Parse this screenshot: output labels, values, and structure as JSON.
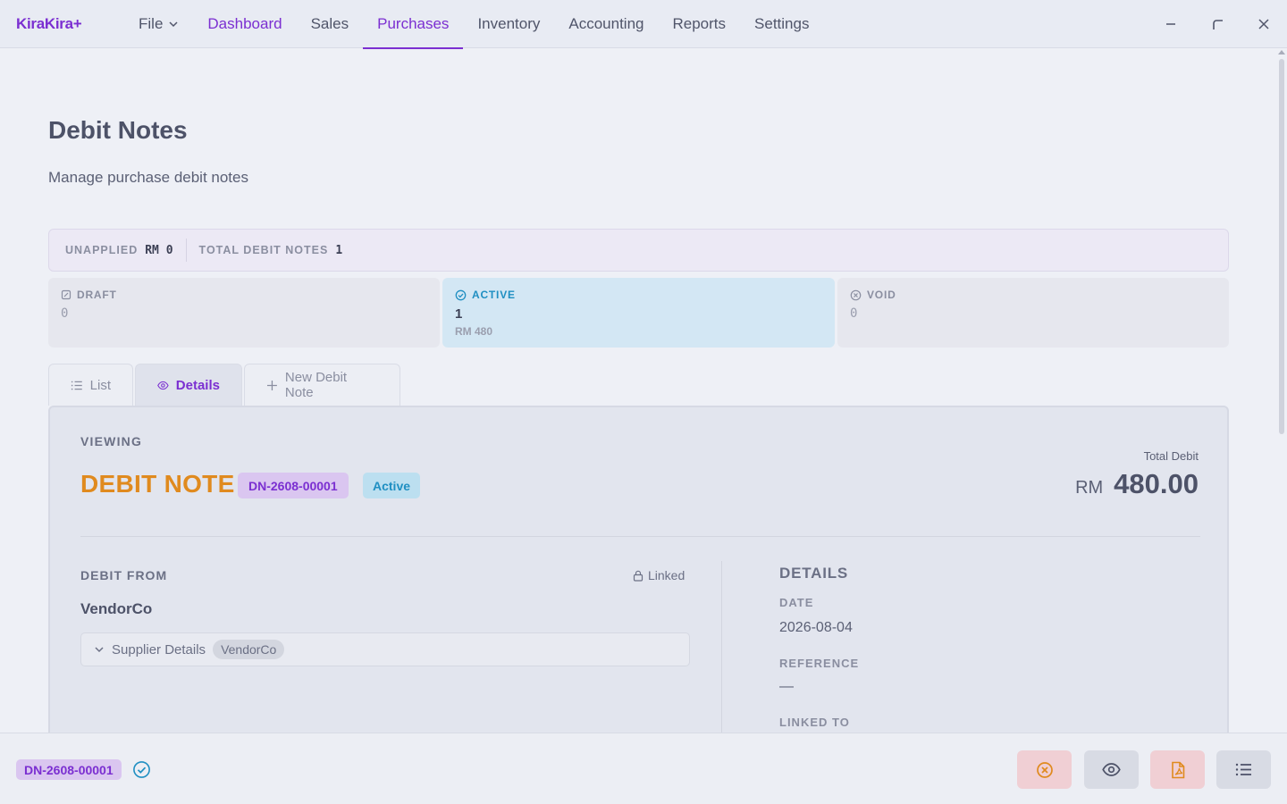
{
  "app": {
    "logo": "KiraKira+"
  },
  "nav": {
    "file": "File",
    "items": [
      "Dashboard",
      "Sales",
      "Purchases",
      "Inventory",
      "Accounting",
      "Reports",
      "Settings"
    ]
  },
  "page": {
    "title": "Debit Notes",
    "subtitle": "Manage purchase debit notes"
  },
  "summary": {
    "unapplied_label": "UNAPPLIED",
    "unapplied_value": "RM 0",
    "total_label": "TOTAL DEBIT NOTES",
    "total_value": "1"
  },
  "status_cards": {
    "draft": {
      "label": "DRAFT",
      "count": "0"
    },
    "active": {
      "label": "ACTIVE",
      "count": "1",
      "amount": "RM 480"
    },
    "void": {
      "label": "VOID",
      "count": "0"
    }
  },
  "tabs": {
    "list": "List",
    "details": "Details",
    "new": "New Debit Note"
  },
  "detail": {
    "viewing": "VIEWING",
    "doc_type": "DEBIT NOTE",
    "doc_number": "DN-2608-00001",
    "status": "Active",
    "total_label": "Total Debit",
    "total_currency": "RM",
    "total_amount": "480.00",
    "debit_from_label": "DEBIT FROM",
    "linked_label": "Linked",
    "vendor": "VendorCo",
    "supplier_details_label": "Supplier Details",
    "supplier_chip": "VendorCo",
    "details_title": "DETAILS",
    "date_label": "DATE",
    "date_value": "2026-08-04",
    "reference_label": "REFERENCE",
    "reference_value": "—",
    "linked_to_label": "LINKED TO"
  },
  "bottom": {
    "doc_number": "DN-2608-00001"
  },
  "colors": {
    "accent": "#7b2fd1",
    "doc_type": "#e08a1e",
    "active": "#1f8fc2",
    "danger_bg": "#f0cfd4"
  }
}
